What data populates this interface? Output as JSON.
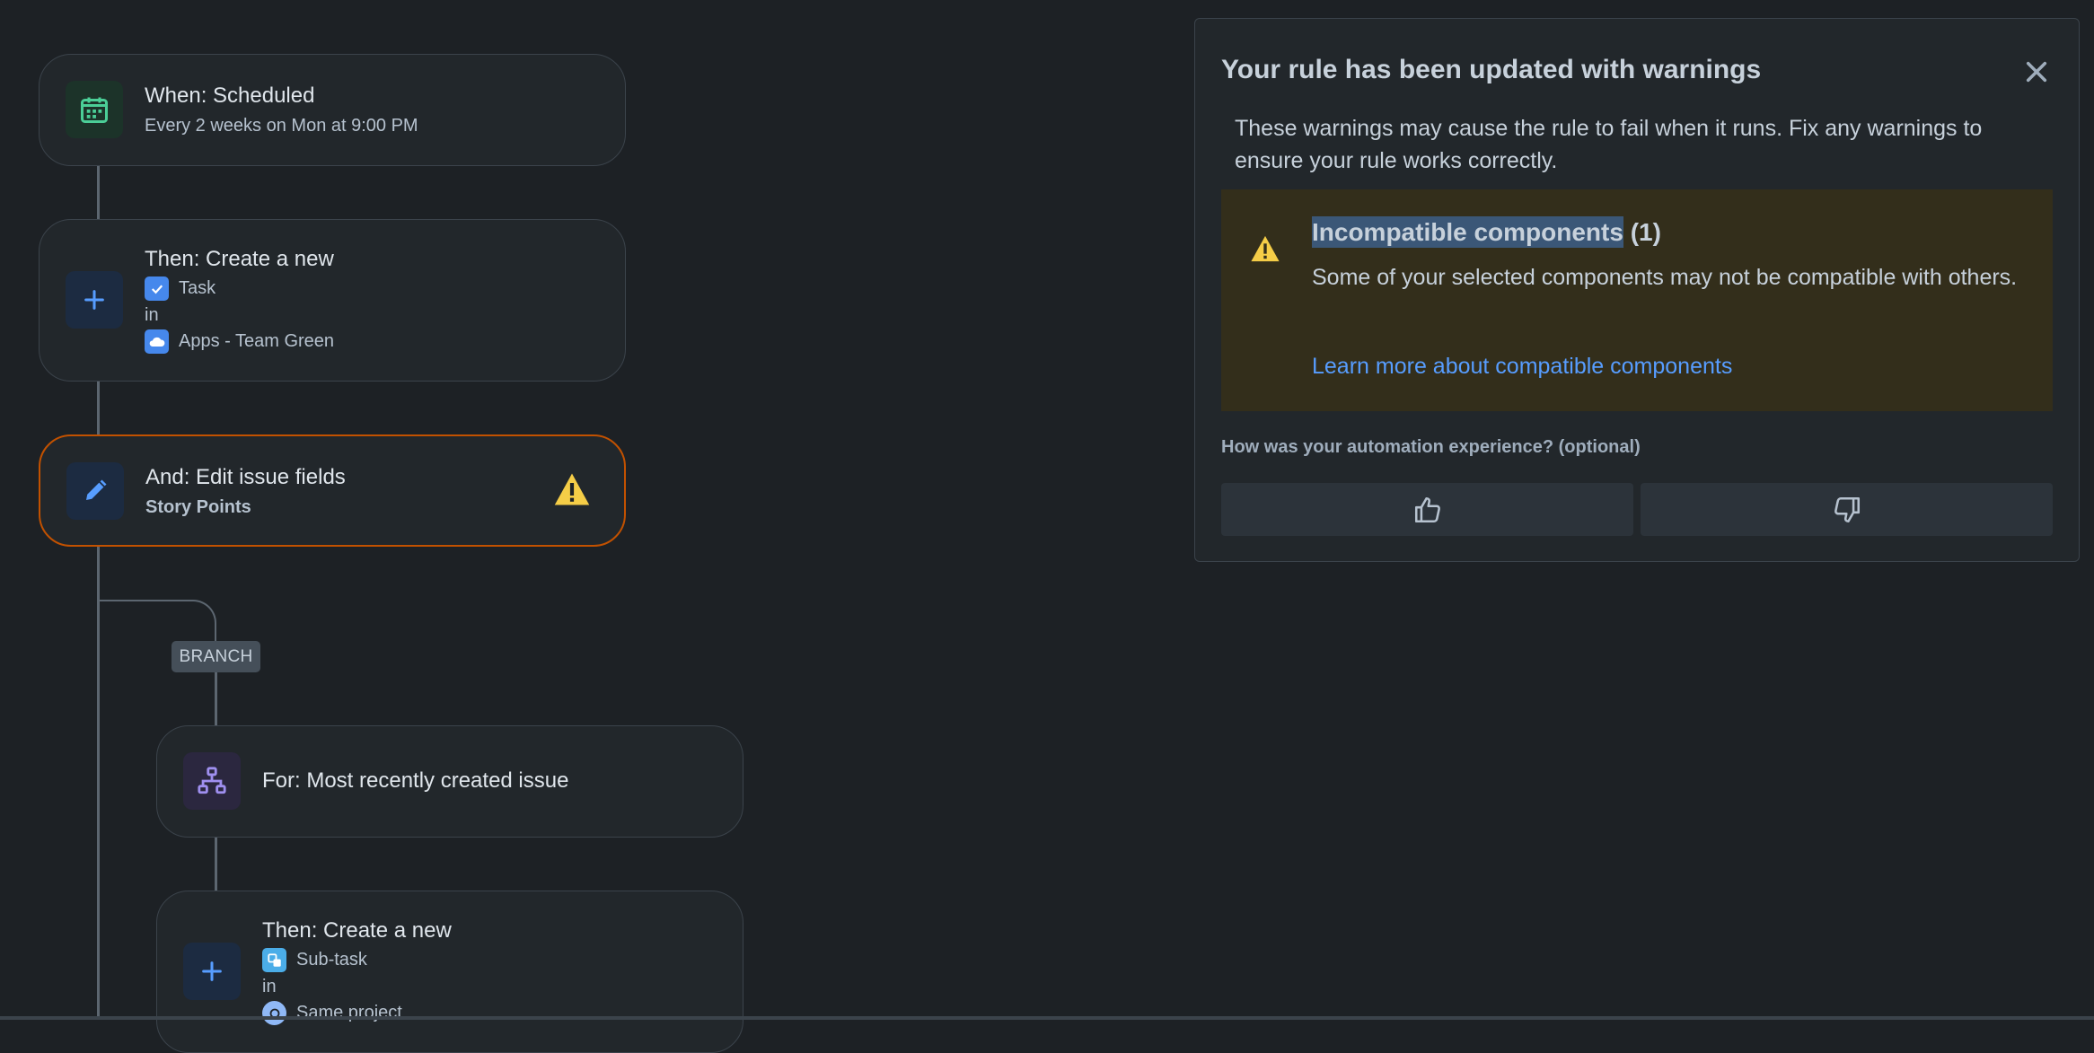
{
  "colors": {
    "background": "#1d2125",
    "node_bg": "#22272b",
    "warning_border": "#c25100",
    "warning_box": "#332e1b",
    "link": "#579dff",
    "trigger_green": "#4bce97",
    "action_blue": "#579dff",
    "branch_purple": "#9f8fef",
    "warning_yellow": "#f5cd47"
  },
  "flow": {
    "trigger": {
      "title": "When: Scheduled",
      "subtitle": "Every 2 weeks on Mon at 9:00 PM",
      "icon": "calendar-icon"
    },
    "create_task": {
      "title": "Then: Create a new",
      "issue_type": "Task",
      "in_label": "in",
      "project": "Apps - Team Green",
      "icon": "plus-icon"
    },
    "edit_fields": {
      "title": "And: Edit issue fields",
      "field": "Story Points",
      "icon": "pencil-icon",
      "status_icon": "warning-icon"
    },
    "branch": {
      "tag": "BRANCH"
    },
    "for_branch": {
      "title": "For: Most recently created issue",
      "icon": "branch-hierarchy-icon"
    },
    "create_subtask": {
      "title": "Then: Create a new",
      "issue_type": "Sub-task",
      "in_label": "in",
      "project": "Same project",
      "icon": "plus-icon"
    }
  },
  "flag": {
    "title": "Your rule has been updated with warnings",
    "close_icon": "close-icon",
    "description": "These warnings may cause the rule to fail when it runs. Fix any warnings to ensure your rule works correctly.",
    "warning": {
      "heading": "Incompatible components",
      "count": "(1)",
      "text": "Some of your selected components may not be compatible with others.",
      "link": "Learn more about compatible components"
    },
    "feedback": {
      "question": "How was your automation experience? (optional)",
      "like_icon": "thumbs-up-icon",
      "dislike_icon": "thumbs-down-icon"
    }
  }
}
